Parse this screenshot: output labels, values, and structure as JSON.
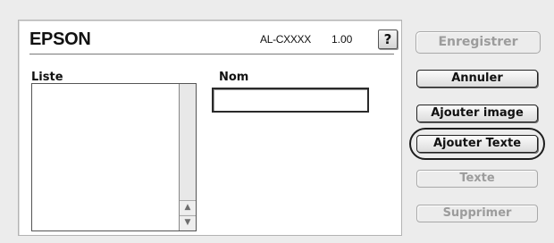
{
  "header": {
    "brand": "EPSON",
    "model": "AL-CXXXX",
    "version": "1.00",
    "help_label": "?"
  },
  "list": {
    "label": "Liste",
    "items": []
  },
  "name_field": {
    "label": "Nom",
    "value": ""
  },
  "buttons": {
    "save": "Enregistrer",
    "cancel": "Annuler",
    "add_image": "Ajouter image",
    "add_text": "Ajouter Texte",
    "text": "Texte",
    "delete": "Supprimer"
  },
  "scroll_icons": {
    "up": "scroll-up-arrow",
    "down": "scroll-down-arrow"
  }
}
